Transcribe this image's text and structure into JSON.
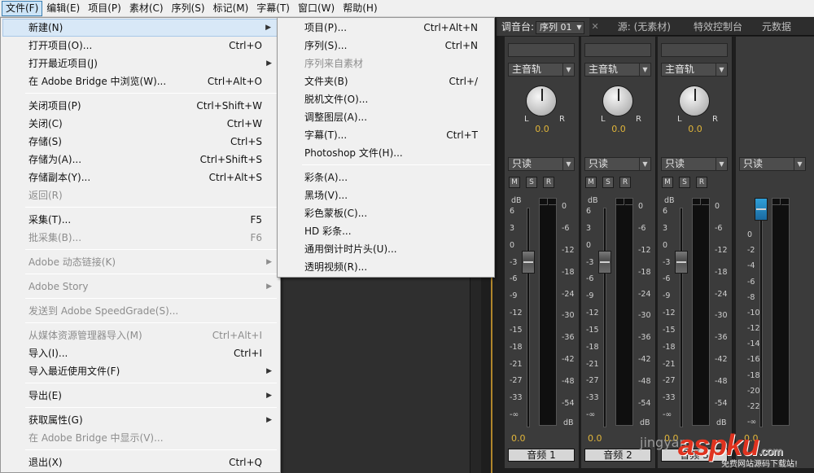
{
  "menubar": [
    {
      "label": "文件(F)",
      "active": true
    },
    {
      "label": "编辑(E)"
    },
    {
      "label": "项目(P)"
    },
    {
      "label": "素材(C)"
    },
    {
      "label": "序列(S)"
    },
    {
      "label": "标记(M)"
    },
    {
      "label": "字幕(T)"
    },
    {
      "label": "窗口(W)"
    },
    {
      "label": "帮助(H)"
    }
  ],
  "file_menu": [
    {
      "label": "新建(N)",
      "submenu": true,
      "highlight": true
    },
    {
      "label": "打开项目(O)...",
      "shortcut": "Ctrl+O"
    },
    {
      "label": "打开最近项目(J)",
      "submenu": true
    },
    {
      "label": "在 Adobe Bridge 中浏览(W)...",
      "shortcut": "Ctrl+Alt+O"
    },
    {
      "separator": true
    },
    {
      "label": "关闭项目(P)",
      "shortcut": "Ctrl+Shift+W"
    },
    {
      "label": "关闭(C)",
      "shortcut": "Ctrl+W"
    },
    {
      "label": "存储(S)",
      "shortcut": "Ctrl+S"
    },
    {
      "label": "存储为(A)...",
      "shortcut": "Ctrl+Shift+S"
    },
    {
      "label": "存储副本(Y)...",
      "shortcut": "Ctrl+Alt+S"
    },
    {
      "label": "返回(R)",
      "disabled": true
    },
    {
      "separator": true
    },
    {
      "label": "采集(T)...",
      "shortcut": "F5"
    },
    {
      "label": "批采集(B)...",
      "shortcut": "F6",
      "disabled": true
    },
    {
      "separator": true
    },
    {
      "label": "Adobe 动态链接(K)",
      "submenu": true,
      "disabled": true
    },
    {
      "separator": true
    },
    {
      "label": "Adobe Story",
      "submenu": true,
      "disabled": true
    },
    {
      "separator": true
    },
    {
      "label": "发送到 Adobe SpeedGrade(S)...",
      "disabled": true
    },
    {
      "separator": true
    },
    {
      "label": "从媒体资源管理器导入(M)",
      "shortcut": "Ctrl+Alt+I",
      "disabled": true
    },
    {
      "label": "导入(I)...",
      "shortcut": "Ctrl+I"
    },
    {
      "label": "导入最近使用文件(F)",
      "submenu": true
    },
    {
      "separator": true
    },
    {
      "label": "导出(E)",
      "submenu": true
    },
    {
      "separator": true
    },
    {
      "label": "获取属性(G)",
      "submenu": true
    },
    {
      "label": "在 Adobe Bridge 中显示(V)...",
      "disabled": true
    },
    {
      "separator": true
    },
    {
      "label": "退出(X)",
      "shortcut": "Ctrl+Q"
    }
  ],
  "new_submenu": [
    {
      "label": "项目(P)...",
      "shortcut": "Ctrl+Alt+N"
    },
    {
      "label": "序列(S)...",
      "shortcut": "Ctrl+N"
    },
    {
      "label": "序列来自素材",
      "disabled": true
    },
    {
      "label": "文件夹(B)",
      "shortcut": "Ctrl+/"
    },
    {
      "label": "脱机文件(O)..."
    },
    {
      "label": "调整图层(A)..."
    },
    {
      "label": "字幕(T)...",
      "shortcut": "Ctrl+T"
    },
    {
      "label": "Photoshop 文件(H)..."
    },
    {
      "separator": true
    },
    {
      "label": "彩条(A)..."
    },
    {
      "label": "黑场(V)..."
    },
    {
      "label": "彩色蒙板(C)..."
    },
    {
      "label": "HD 彩条..."
    },
    {
      "label": "通用倒计时片头(U)..."
    },
    {
      "label": "透明视频(R)..."
    }
  ],
  "mixer": {
    "tab_label": "调音台: 序列 01",
    "tab_seq_label": "调音台:",
    "tab_seq_value": "序列 01",
    "tab_source": "源: (无素材)",
    "tab_effect": "特效控制台",
    "tab_meta": "元数据",
    "channels": [
      {
        "route": "主音轨",
        "pan": "0.0",
        "mode": "只读",
        "volume": "0.0",
        "name": "音频 1"
      },
      {
        "route": "主音轨",
        "pan": "0.0",
        "mode": "只读",
        "volume": "0.0",
        "name": "音频 2"
      },
      {
        "route": "主音轨",
        "pan": "0.0",
        "mode": "只读",
        "volume": "0.0",
        "name": "音频 3"
      }
    ],
    "master": {
      "mode": "只读",
      "volume": "0.0"
    },
    "btn_m": "M",
    "btn_s": "S",
    "btn_r": "R",
    "knob_l": "L",
    "knob_r": "R",
    "db_unit": "dB",
    "fader_scale": [
      "6",
      "3",
      "0",
      "-3",
      "-6",
      "-9",
      "-12",
      "-15",
      "-18",
      "-21",
      "-27",
      "-33",
      "-∞"
    ],
    "meter_scale": [
      "0",
      "-6",
      "-12",
      "-18",
      "-24",
      "-30",
      "-36",
      "-42",
      "-48",
      "-54"
    ],
    "master_scale": [
      "0",
      "-2",
      "-4",
      "-6",
      "-8",
      "-10",
      "-12",
      "-14",
      "-16",
      "-18",
      "-20",
      "-22",
      "-∞"
    ]
  },
  "watermark": {
    "site": "jingyan",
    "logo": "aspku",
    "logo_suffix": ".com",
    "sub": "免费网站源码下载站!"
  }
}
